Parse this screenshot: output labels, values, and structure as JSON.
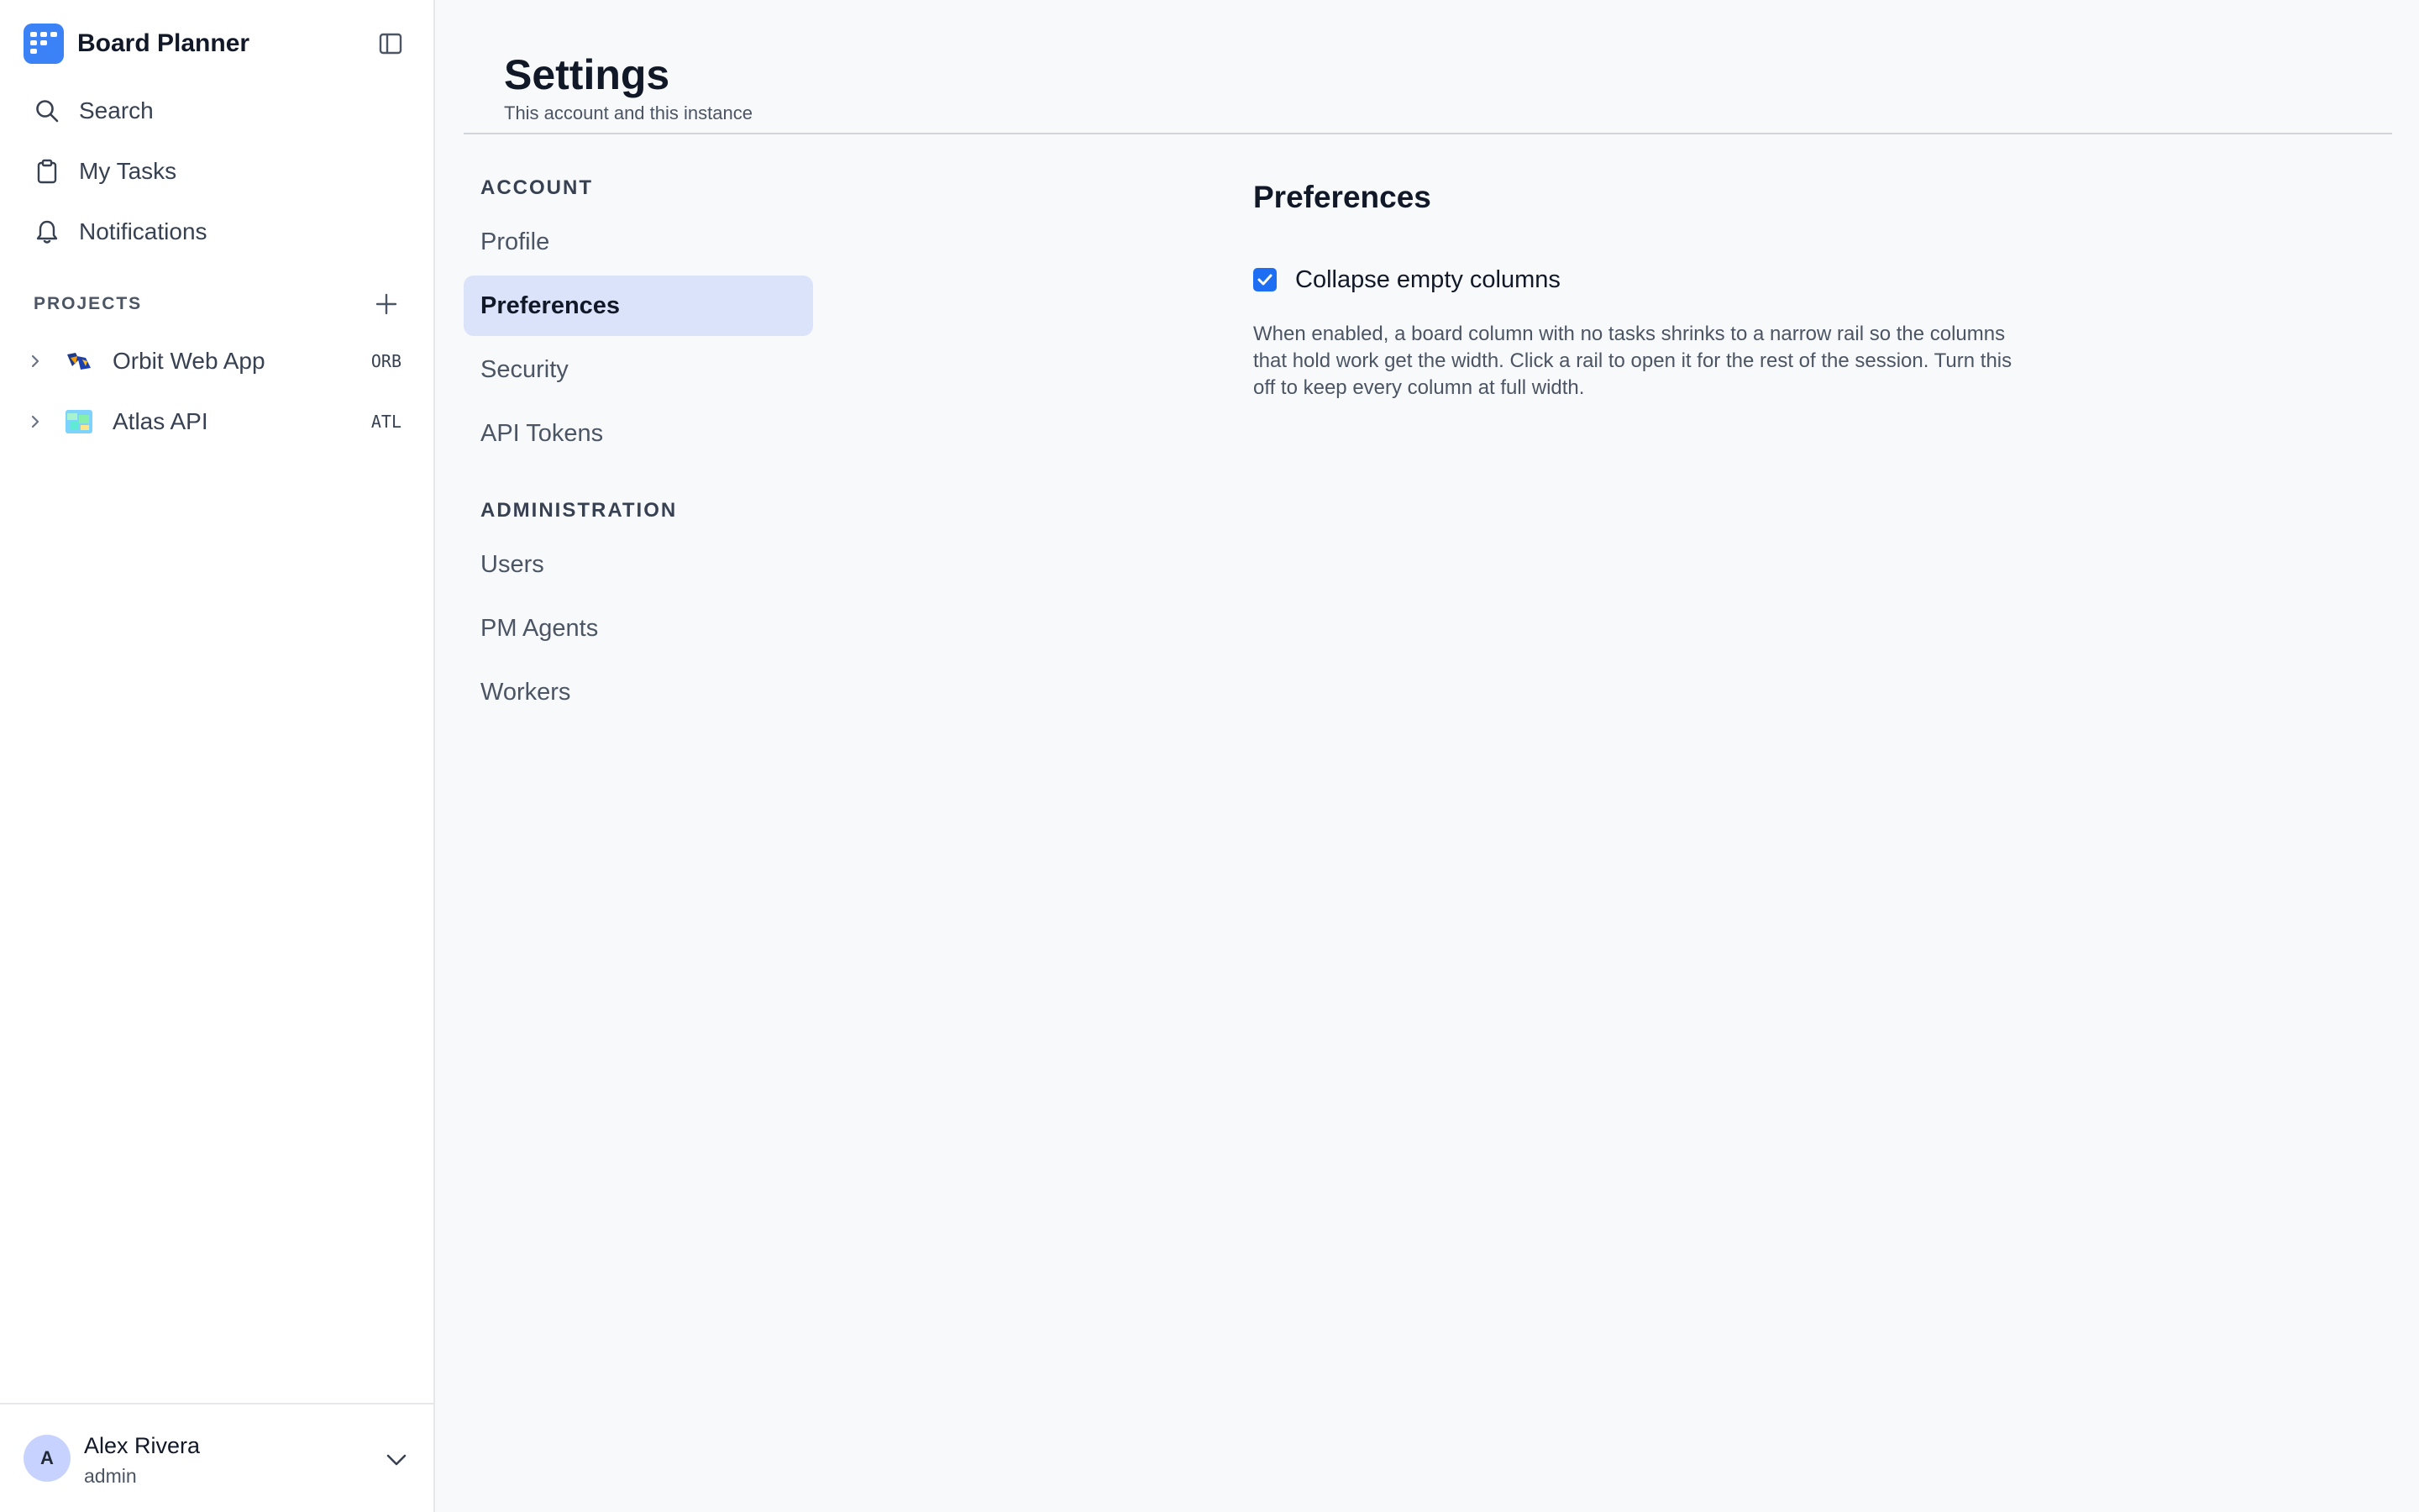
{
  "app": {
    "title": "Board Planner"
  },
  "sidebar": {
    "nav": [
      {
        "label": "Search",
        "icon": "search-icon"
      },
      {
        "label": "My Tasks",
        "icon": "clipboard-icon"
      },
      {
        "label": "Notifications",
        "icon": "bell-icon"
      }
    ],
    "projects_heading": "PROJECTS",
    "projects": [
      {
        "name": "Orbit Web App",
        "key": "ORB"
      },
      {
        "name": "Atlas API",
        "key": "ATL"
      }
    ],
    "user": {
      "initial": "A",
      "name": "Alex Rivera",
      "role": "admin"
    }
  },
  "header": {
    "title": "Settings",
    "subtitle": "This account and this instance"
  },
  "settings_nav": {
    "account_label": "ACCOUNT",
    "account_items": [
      "Profile",
      "Preferences",
      "Security",
      "API Tokens"
    ],
    "admin_label": "ADMINISTRATION",
    "admin_items": [
      "Users",
      "PM Agents",
      "Workers"
    ],
    "active": "Preferences"
  },
  "preferences": {
    "title": "Preferences",
    "collapse_label": "Collapse empty columns",
    "collapse_checked": true,
    "description": "When enabled, a board column with no tasks shrinks to a narrow rail so the columns that hold work get the width. Click a rail to open it for the rest of the session. Turn this off to keep every column at full width."
  },
  "colors": {
    "brand": "#3b82f6",
    "checkbox": "#1d6ef2",
    "active_bg": "#dbe3fa",
    "avatar_bg": "#c7d2fe"
  }
}
